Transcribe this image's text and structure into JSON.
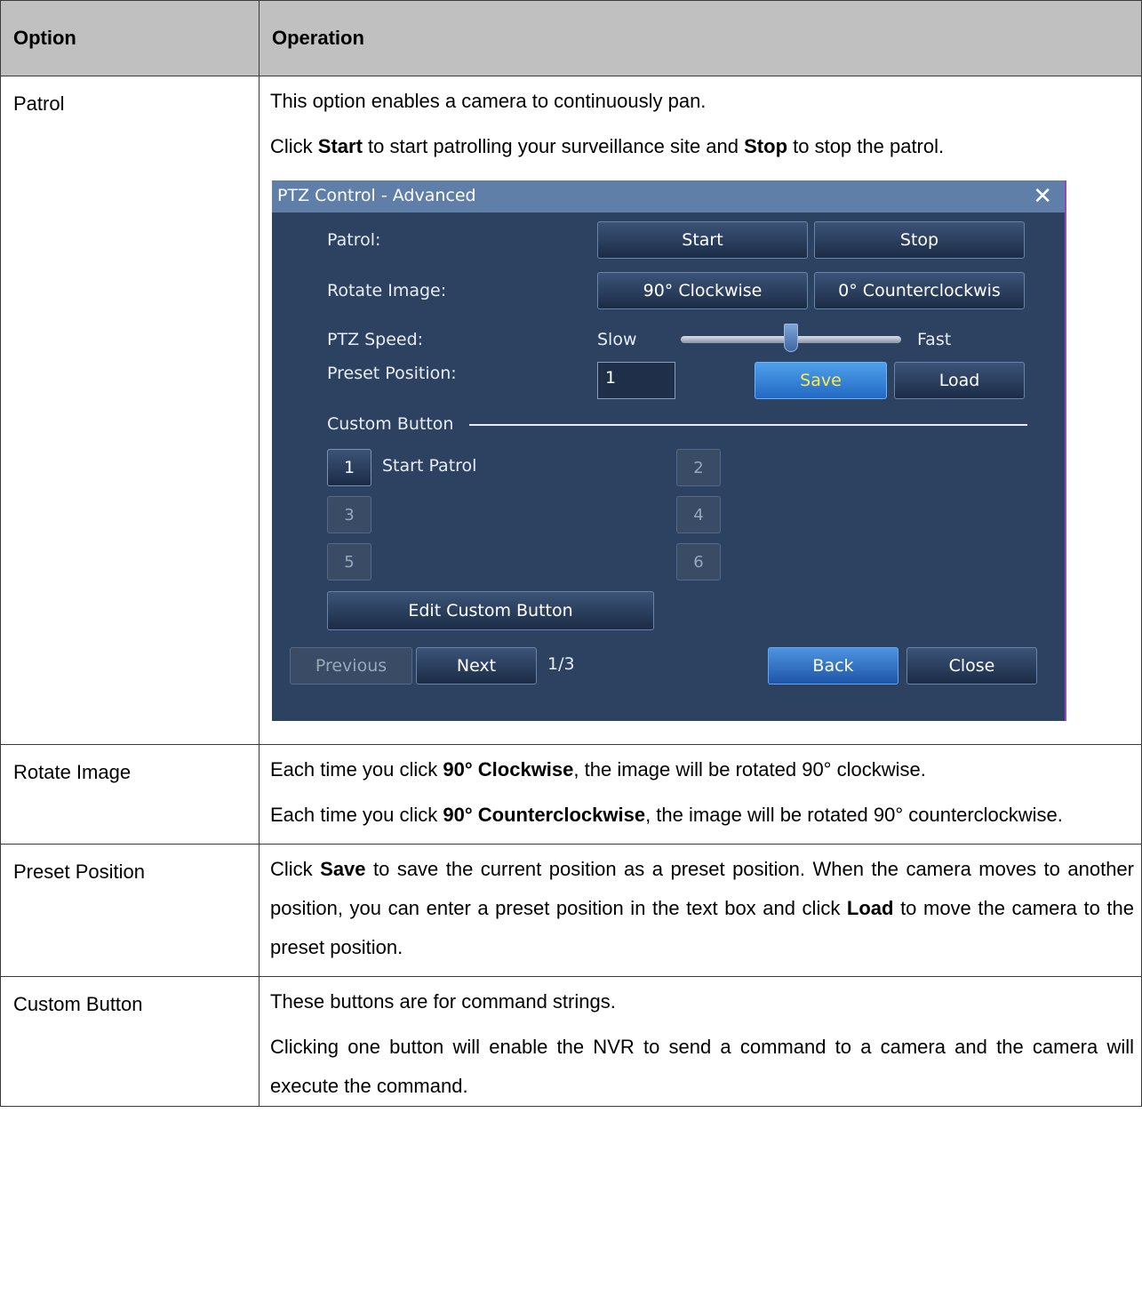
{
  "table": {
    "header": {
      "option": "Option",
      "operation": "Operation"
    },
    "rows": [
      {
        "option": "Patrol",
        "paragraphs": [
          [
            "This option enables a camera to continuously pan."
          ],
          [
            "Click ",
            "Start",
            " to start patrolling your surveillance site and ",
            "Stop",
            " to stop the patrol."
          ]
        ]
      },
      {
        "option": "Rotate Image",
        "paragraphs": [
          [
            "Each time you click ",
            "90° Clockwise",
            ", the image will be rotated 90° clockwise."
          ],
          [
            "Each time you click ",
            "90° Counterclockwise",
            ", the image will be rotated 90° counterclockwise."
          ]
        ]
      },
      {
        "option": "Preset Position",
        "paragraphs": [
          [
            "Click ",
            "Save",
            " to save the current position as a preset position. When the camera moves to another position, you can enter a preset position in the text box and click ",
            "Load",
            " to move the camera to the preset position."
          ]
        ]
      },
      {
        "option": "Custom Button",
        "paragraphs": [
          [
            "These buttons are for command strings."
          ],
          [
            "Clicking one button will enable the NVR to send a command to a camera and the camera will execute the command."
          ]
        ]
      }
    ]
  },
  "dialog": {
    "title": "PTZ Control - Advanced",
    "close_icon": "close-icon",
    "patrol_label": "Patrol:",
    "start": "Start",
    "stop": "Stop",
    "rotate_label": "Rotate Image:",
    "rotate_cw": "90°  Clockwise",
    "rotate_ccw": "0°  Counterclockwis",
    "speed_label": "PTZ Speed:",
    "slow": "Slow",
    "fast": "Fast",
    "speed_level": 0.5,
    "preset_label": "Preset Position:",
    "preset_value": "1",
    "save": "Save",
    "load": "Load",
    "custom_label": "Custom Button",
    "custom_buttons": [
      {
        "num": "1",
        "label": "Start Patrol"
      },
      {
        "num": "2",
        "label": ""
      },
      {
        "num": "3",
        "label": ""
      },
      {
        "num": "4",
        "label": ""
      },
      {
        "num": "5",
        "label": ""
      },
      {
        "num": "6",
        "label": ""
      }
    ],
    "edit_custom": "Edit Custom Button",
    "previous": "Previous",
    "next": "Next",
    "page": "1/3",
    "back": "Back",
    "close": "Close",
    "colors": {
      "dialog_bg": "#2d4161",
      "titlebar": "#5f7fa8",
      "save_text": "#ffe94a"
    }
  }
}
